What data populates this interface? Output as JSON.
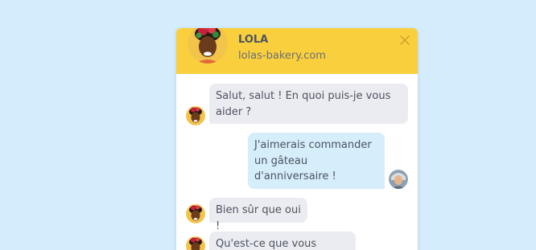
{
  "header": {
    "name": "LOLA",
    "url": "lolas-bakery.com"
  },
  "messages": [
    {
      "sender": "bot",
      "text": "Salut, salut ! En quoi puis-je vous aider ?"
    },
    {
      "sender": "user",
      "text": "J'aimerais commander un gâteau d'anniversaire !"
    },
    {
      "sender": "bot",
      "text": "Bien sûr que oui !"
    },
    {
      "sender": "bot",
      "text": "Qu'est-ce que vous voulez ?"
    }
  ],
  "colors": {
    "background": "#d4ecfb",
    "header": "#f9cf3d",
    "bot_bubble": "#ebecf1",
    "user_bubble": "#d6edfb"
  },
  "icons": {
    "close": "close-icon",
    "bot_avatar": "lola-avatar",
    "user_avatar": "user-avatar"
  }
}
